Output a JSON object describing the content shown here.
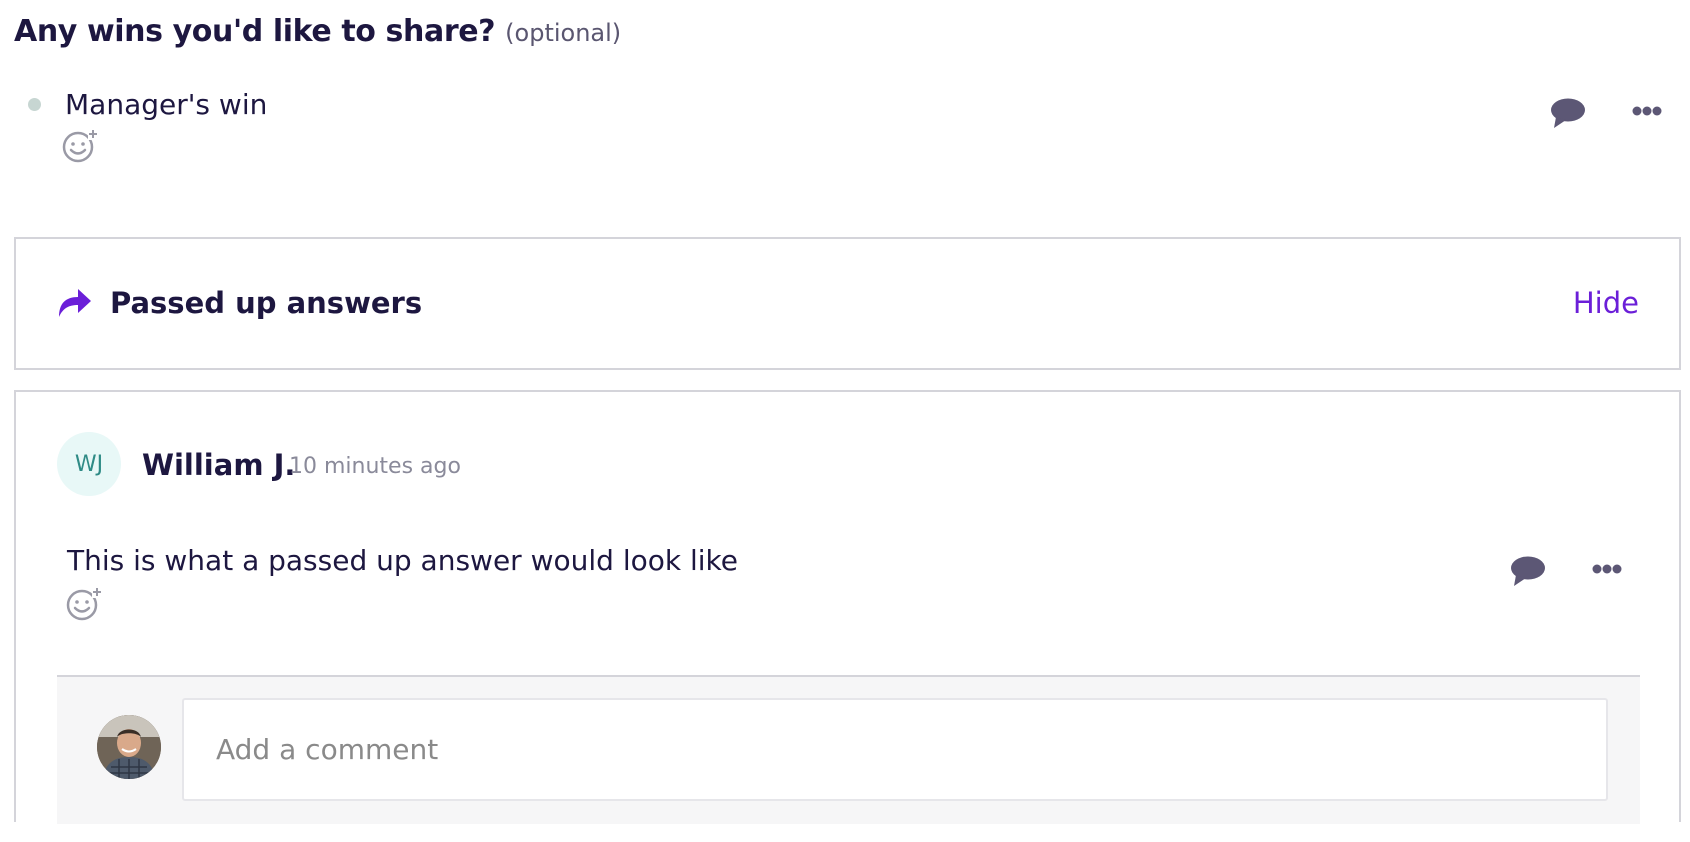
{
  "question": {
    "title": "Any wins you'd like to share?",
    "optional_label": "(optional)"
  },
  "manager_answer": {
    "text": "Manager's win",
    "icons": [
      "add-reaction-icon",
      "comment-icon",
      "more-icon"
    ]
  },
  "passed_up": {
    "label": "Passed up answers",
    "hide_label": "Hide",
    "accent": "#6b1fd8"
  },
  "passed_answer": {
    "author_initials": "WJ",
    "author_name": "William J.",
    "timestamp": "10 minutes ago",
    "text": "This is what a passed up answer would look like"
  },
  "comment": {
    "placeholder": "Add a comment"
  }
}
